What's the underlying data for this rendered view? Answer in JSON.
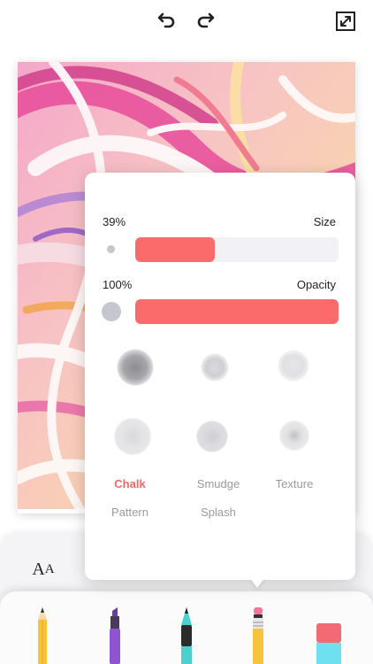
{
  "toolbar": {
    "undo_icon": "undo-icon",
    "redo_icon": "redo-icon",
    "expand_icon": "expand-icon"
  },
  "brush_panel": {
    "size": {
      "value_label": "39%",
      "label": "Size",
      "fraction": 0.39
    },
    "opacity": {
      "value_label": "100%",
      "label": "Opacity",
      "fraction": 1.0
    },
    "accent_color": "#fb6b6b",
    "brushes": [
      {
        "name": "Chalk",
        "selected": true
      },
      {
        "name": "Smudge",
        "selected": false
      },
      {
        "name": "Texture",
        "selected": false
      },
      {
        "name": "Pattern",
        "selected": false
      },
      {
        "name": "Splash",
        "selected": false
      }
    ]
  },
  "bottom_tabs": {
    "text_tab_big": "A",
    "text_tab_small": "A"
  },
  "tools": [
    "pencil-icon",
    "marker-icon",
    "pen-icon",
    "brush-pencil-icon",
    "eraser-icon"
  ]
}
